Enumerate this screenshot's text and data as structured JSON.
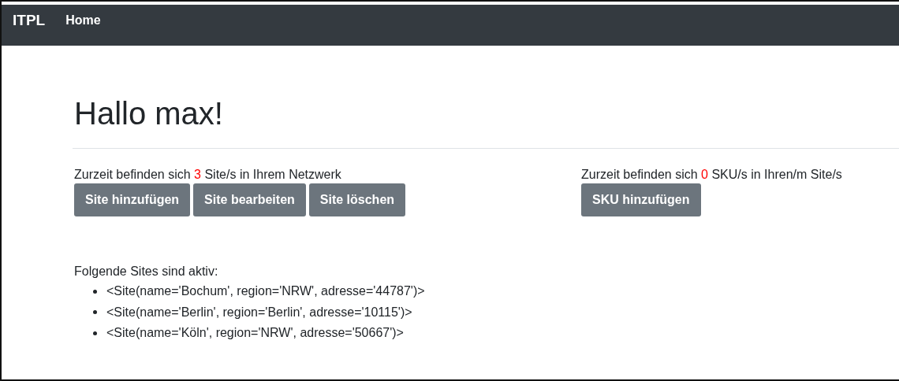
{
  "navbar": {
    "brand": "ITPL",
    "links": [
      "Home"
    ]
  },
  "heading": "Hallo max!",
  "sites_panel": {
    "prefix": "Zurzeit befinden sich ",
    "count": "3",
    "suffix": " Site/s in Ihrem Netzwerk",
    "buttons": [
      "Site hinzufügen",
      "Site bearbeiten",
      "Site löschen"
    ]
  },
  "sku_panel": {
    "prefix": "Zurzeit befinden sich ",
    "count": "0",
    "suffix": " SKU/s in Ihren/m Site/s",
    "buttons": [
      "SKU hinzufügen"
    ]
  },
  "active_sites": {
    "title": "Folgende Sites sind aktiv:",
    "items": [
      "<Site(name='Bochum', region='NRW', adresse='44787')>",
      "<Site(name='Berlin', region='Berlin', adresse='10115')>",
      "<Site(name='Köln', region='NRW', adresse='50667')>"
    ]
  }
}
